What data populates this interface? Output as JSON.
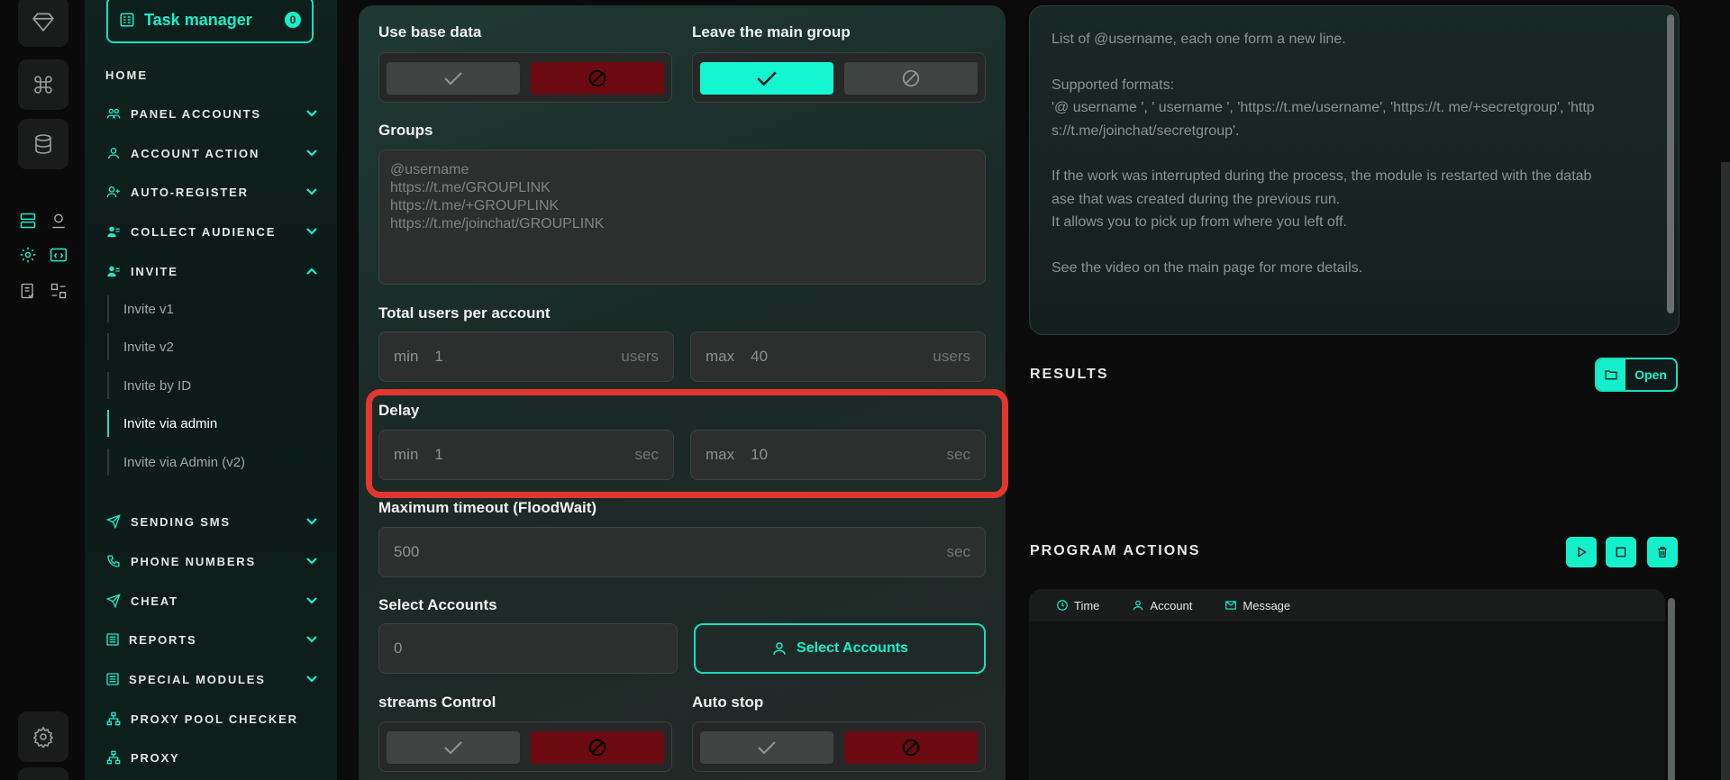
{
  "sidebar": {
    "task_manager_label": "Task manager",
    "task_manager_count": "0",
    "home": "HOME",
    "nav_items": [
      {
        "label": "PANEL ACCOUNTS"
      },
      {
        "label": "ACCOUNT ACTION"
      },
      {
        "label": "AUTO-REGISTER"
      },
      {
        "label": "COLLECT AUDIENCE"
      },
      {
        "label": "INVITE"
      },
      {
        "label": "SENDING SMS"
      },
      {
        "label": "PHONE NUMBERS"
      },
      {
        "label": "CHEAT"
      },
      {
        "label": "REPORTS"
      },
      {
        "label": "SPECIAL MODULES"
      },
      {
        "label": "PROXY POOL CHECKER"
      },
      {
        "label": "PROXY"
      }
    ],
    "invite_sub": [
      "Invite v1",
      "Invite v2",
      "Invite by ID",
      "Invite via admin",
      "Invite via Admin (v2)"
    ]
  },
  "form": {
    "use_base_data": "Use base data",
    "leave_main_group": "Leave the main group",
    "groups_label": "Groups",
    "groups_placeholder": "@username\nhttps://t.me/GROUPLINK\nhttps://t.me/+GROUPLINK\nhttps://t.me/joinchat/GROUPLINK",
    "total_users_label": "Total users per account",
    "total_min_prefix": "min",
    "total_min_value": "1",
    "total_min_unit": "users",
    "total_max_prefix": "max",
    "total_max_value": "40",
    "total_max_unit": "users",
    "delay_label": "Delay",
    "delay_min_prefix": "min",
    "delay_min_value": "1",
    "delay_min_unit": "sec",
    "delay_max_prefix": "max",
    "delay_max_value": "10",
    "delay_max_unit": "sec",
    "timeout_label": "Maximum timeout (FloodWait)",
    "timeout_value": "500",
    "timeout_unit": "sec",
    "select_accounts_label": "Select Accounts",
    "select_accounts_value": "0",
    "select_accounts_button": "Select Accounts",
    "streams_control": "streams Control",
    "auto_stop": "Auto stop"
  },
  "info": {
    "lines": [
      "List of @username, each one form a new line.",
      "",
      "Supported formats:",
      "'@ username ', ' username ', 'https://t.me/username', 'https://t. me/+secretgroup', 'http",
      "s://t.me/joinchat/secretgroup'.",
      "",
      "If the work was interrupted during the process, the module is restarted with the datab",
      "ase that was created during the previous run.",
      "It allows you to pick up from where you left off.",
      "",
      "See the video on the main page for more details."
    ]
  },
  "results": {
    "title": "RESULTS",
    "open_button": "Open"
  },
  "program_actions": {
    "title": "PROGRAM ACTIONS",
    "columns": [
      "Time",
      "Account",
      "Message"
    ]
  },
  "colors": {
    "accent": "#14f0cc",
    "danger": "#6b0a10",
    "highlight": "#e2362e"
  }
}
